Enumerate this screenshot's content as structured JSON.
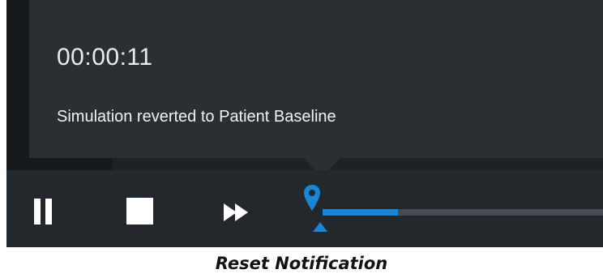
{
  "notification": {
    "timestamp": "00:00:11",
    "message": "Simulation reverted to Patient Baseline"
  },
  "playback": {
    "progress": 0.27,
    "icons": {
      "pause": "pause-icon",
      "stop": "stop-icon",
      "fast_forward": "fast-forward-icon",
      "marker": "map-pin-icon",
      "playhead": "triangle-up-icon"
    }
  },
  "colors": {
    "accent": "#1a86d6",
    "panel": "#2a2f33",
    "controls_bg": "#23282c",
    "track": "#454b50"
  },
  "caption": "Reset Notification"
}
